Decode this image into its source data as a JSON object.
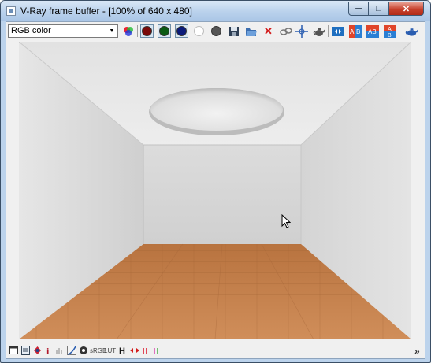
{
  "window": {
    "title": "V-Ray frame buffer - [100% of 640 x 480]",
    "min_glyph": "─",
    "max_glyph": "□",
    "close_glyph": "✕"
  },
  "toolbar": {
    "channel_value": "RGB color",
    "icons": [
      "rgb-channels-icon",
      "red-channel-icon",
      "green-channel-icon",
      "blue-channel-icon",
      "alpha-channel-icon",
      "mono-channel-icon",
      "save-icon",
      "open-icon",
      "clear-icon",
      "link-icon",
      "track-mouse-icon",
      "teapot-region-icon",
      "compare-icon",
      "ab-horizontal-icon",
      "ab-vertical-icon",
      "ab-swap-icon",
      "render-teapot-icon"
    ]
  },
  "statusbar": {
    "info_label": "i",
    "srgb_label": "sRGB",
    "lut_label": "LUT",
    "histogram_label": "H",
    "expand_glyph": "»"
  },
  "colors": {
    "title_bar": "#b9d1ec",
    "close_button": "#c7402c",
    "floor": "#c98752",
    "walls": "#e4e4e4"
  }
}
